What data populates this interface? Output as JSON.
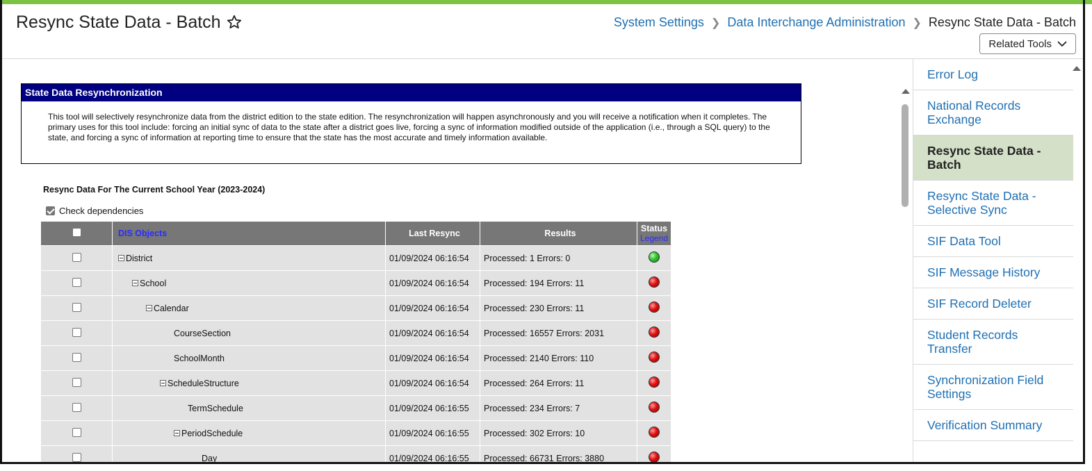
{
  "header": {
    "title": "Resync State Data - Batch",
    "breadcrumb": [
      "System Settings",
      "Data Interchange Administration",
      "Resync State Data - Batch"
    ],
    "related_tools": "Related Tools"
  },
  "panel": {
    "title": "State Data Resynchronization",
    "body": "This tool will selectively resynchronize data from the district edition to the state edition. The resynchronization will happen asynchronously and you will receive a notification when it completes. The primary uses for this tool include: forcing an initial sync of data to the state after a district goes live, forcing a sync of information modified outside of the application (i.e., through a SQL query) to the state, and forcing a sync of information at reporting time to ensure that the state has the most accurate and timely information available."
  },
  "section_title": "Resync Data For The Current School Year (2023-2024)",
  "check_dependencies": {
    "label": "Check dependencies",
    "checked": true
  },
  "table": {
    "headers": {
      "objects": "DIS Objects",
      "last_resync": "Last Resync",
      "results": "Results",
      "status": "Status",
      "legend": "Legend"
    },
    "rows": [
      {
        "name": "District",
        "collapsible": true,
        "date": "01/09/2024 06:16:54",
        "results": "Processed: 1 Errors: 0",
        "status": "green"
      },
      {
        "name": "School",
        "collapsible": true,
        "date": "01/09/2024 06:16:54",
        "results": "Processed: 194 Errors: 11",
        "status": "red"
      },
      {
        "name": "Calendar",
        "collapsible": true,
        "date": "01/09/2024 06:16:54",
        "results": "Processed: 230 Errors: 11",
        "status": "red"
      },
      {
        "name": "CourseSection",
        "collapsible": false,
        "date": "01/09/2024 06:16:54",
        "results": "Processed: 16557 Errors: 2031",
        "status": "red"
      },
      {
        "name": "SchoolMonth",
        "collapsible": false,
        "date": "01/09/2024 06:16:54",
        "results": "Processed: 2140 Errors: 110",
        "status": "red"
      },
      {
        "name": "ScheduleStructure",
        "collapsible": true,
        "date": "01/09/2024 06:16:54",
        "results": "Processed: 264 Errors: 11",
        "status": "red"
      },
      {
        "name": "TermSchedule",
        "collapsible": false,
        "date": "01/09/2024 06:16:55",
        "results": "Processed: 234 Errors: 7",
        "status": "red"
      },
      {
        "name": "PeriodSchedule",
        "collapsible": true,
        "date": "01/09/2024 06:16:55",
        "results": "Processed: 302 Errors: 10",
        "status": "red"
      },
      {
        "name": "Day",
        "collapsible": false,
        "date": "01/09/2024 06:16:55",
        "results": "Processed: 66731 Errors: 3880",
        "status": "red"
      }
    ]
  },
  "sidebar": {
    "items": [
      {
        "label": "Error Log",
        "active": false
      },
      {
        "label": "National Records Exchange",
        "active": false
      },
      {
        "label": "Resync State Data - Batch",
        "active": true
      },
      {
        "label": "Resync State Data - Selective Sync",
        "active": false
      },
      {
        "label": "SIF Data Tool",
        "active": false
      },
      {
        "label": "SIF Message History",
        "active": false
      },
      {
        "label": "SIF Record Deleter",
        "active": false
      },
      {
        "label": "Student Records Transfer",
        "active": false
      },
      {
        "label": "Synchronization Field Settings",
        "active": false
      },
      {
        "label": "Verification Summary",
        "active": false
      }
    ]
  },
  "colors": {
    "brand_green": "#7cc243",
    "link_blue": "#1f6fb2",
    "panel_navy": "#000080",
    "active_bg": "#d4e0c8"
  }
}
